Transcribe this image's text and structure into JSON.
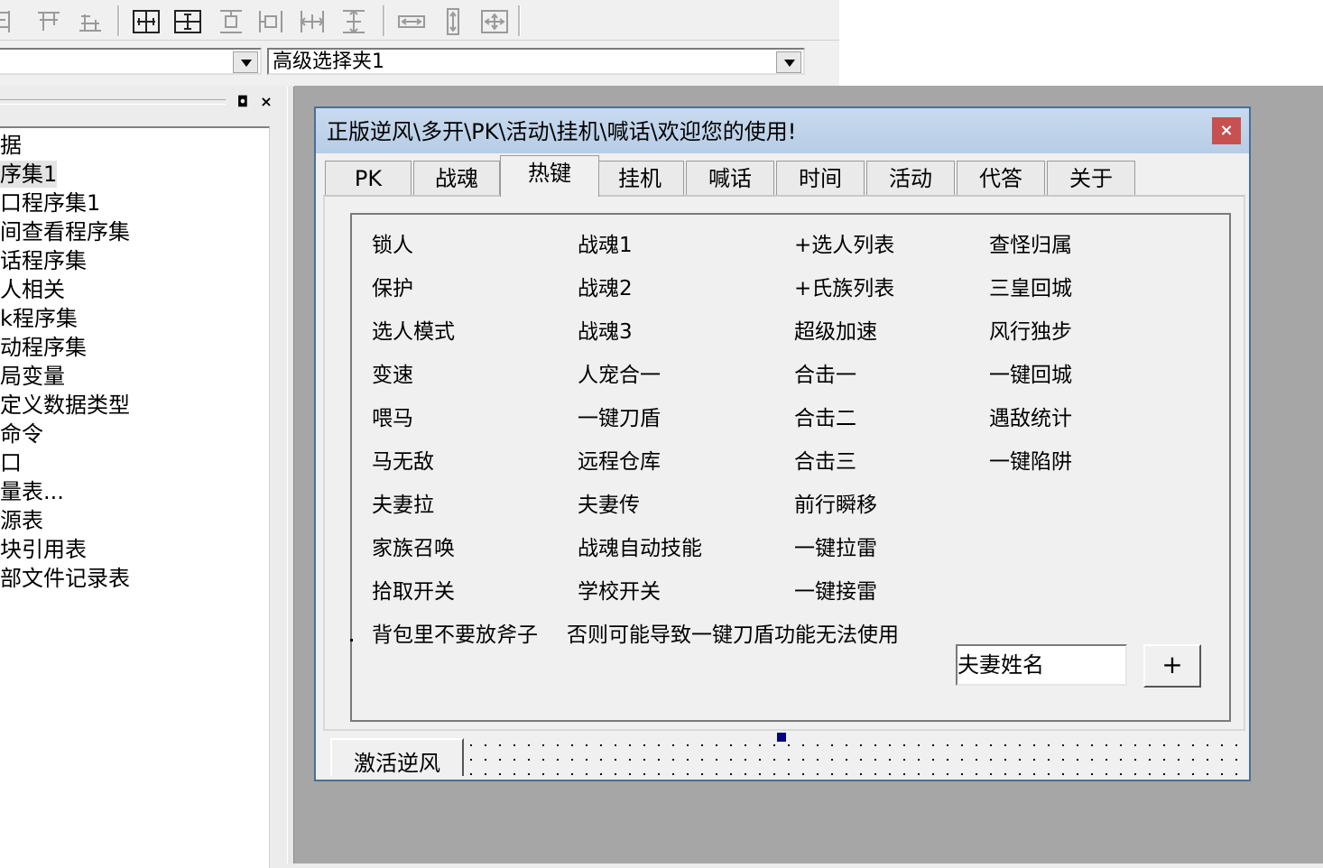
{
  "toolbar": {
    "icons": [
      "align-left-icon",
      "align-top-icon",
      "align-bottom-icon",
      "center-horizontal-icon",
      "center-vertical-icon",
      "distribute-top-icon",
      "distribute-horizontal-icon",
      "same-width-spacing-icon",
      "same-height-spacing-icon",
      "same-width-icon",
      "same-height-icon",
      "same-size-icon"
    ]
  },
  "combos": {
    "left": {
      "value": ""
    },
    "right": {
      "value": "高级选择夹1"
    }
  },
  "left_panel": {
    "float_button": "◘",
    "close_button": "×",
    "items": [
      "据",
      "序集1",
      "口程序集1",
      "间查看程序集",
      "话程序集",
      "人相关",
      "k程序集",
      "动程序集",
      "局变量",
      "定义数据类型",
      "命令",
      "口",
      "量表...",
      "源表",
      "块引用表",
      "部文件记录表"
    ]
  },
  "form": {
    "title": "正版逆风\\多开\\PK\\活动\\挂机\\喊话\\欢迎您的使用!",
    "close_label": "×",
    "tabs": [
      "PK",
      "战魂",
      "热键",
      "挂机",
      "喊话",
      "时间",
      "活动",
      "代答",
      "关于"
    ],
    "active_tab": "热键",
    "hotkeys": {
      "col1": [
        "锁人",
        "保护",
        "选人模式",
        "变速",
        "喂马",
        "马无敌",
        "夫妻拉",
        "家族召唤",
        "拾取开关"
      ],
      "col2": [
        "战魂1",
        "战魂2",
        "战魂3",
        "人宠合一",
        "一键刀盾",
        "远程仓库",
        "夫妻传",
        "战魂自动技能",
        "学校开关"
      ],
      "col3": [
        "+选人列表",
        "+氏族列表",
        "超级加速",
        "合击一",
        "合击二",
        "合击三",
        "前行瞬移",
        "一键拉雷",
        "一键接雷"
      ],
      "col4": [
        "查怪归属",
        "三皇回城",
        "风行独步",
        "一键回城",
        "遇敌统计",
        "一键陷阱"
      ]
    },
    "note_left": "背包里不要放斧子",
    "note_right": "否则可能导致一键刀盾功能无法使用",
    "spouse_input": "夫妻姓名",
    "plus_button": "+",
    "activate_button": "激活逆风"
  },
  "colors": {
    "surface": "#a6a6a6",
    "titlebar": "#b7cde6",
    "close": "#c75050",
    "handle": "#000080"
  }
}
